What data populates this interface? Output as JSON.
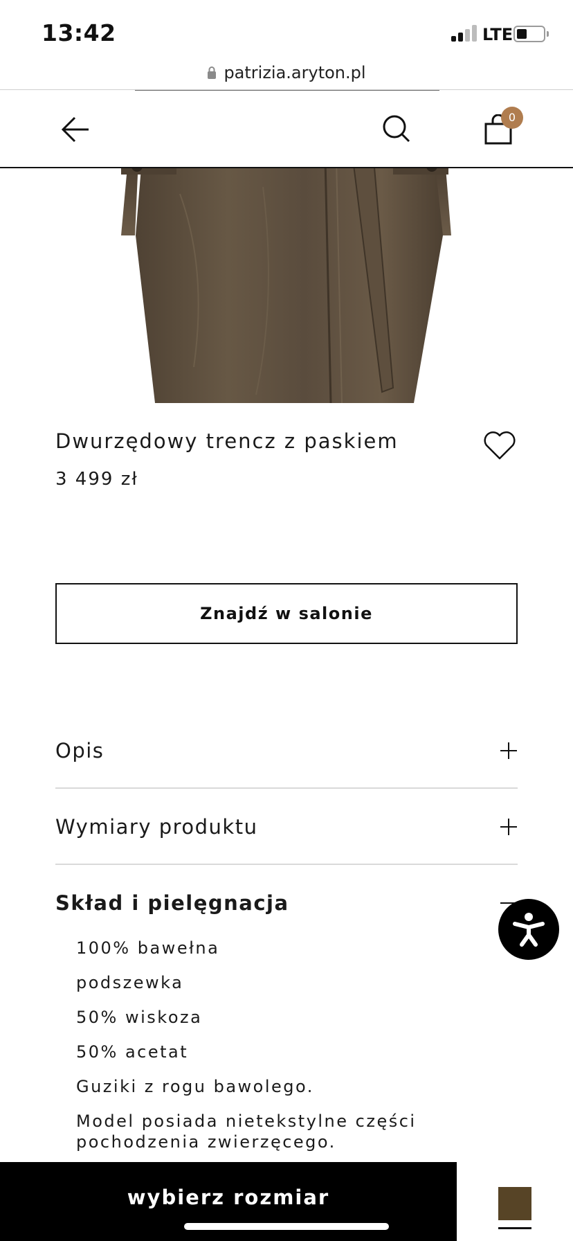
{
  "status_bar": {
    "time": "13:42",
    "network": "LTE",
    "signal_bars_active": 2,
    "signal_bars_total": 4,
    "battery_level": 0.3
  },
  "browser": {
    "url": "patrizia.aryton.pl",
    "lock_icon": "lock-icon"
  },
  "header": {
    "back_icon": "arrow-left-icon",
    "search_icon": "search-icon",
    "cart_icon": "shopping-bag-icon",
    "cart_count": "0",
    "badge_color": "#b07d4f"
  },
  "product": {
    "title": "Dwurzędowy trencz z paskiem",
    "price": "3 499 zł",
    "image_color": "#5a4c3d",
    "wishlist_icon": "heart-icon"
  },
  "store_button": {
    "label": "Znajdź w salonie"
  },
  "accordion": [
    {
      "title": "Opis",
      "icon": "plus-icon",
      "expanded": false
    },
    {
      "title": "Wymiary produktu",
      "icon": "plus-icon",
      "expanded": false
    },
    {
      "title": "Skład i pielęgnacja",
      "icon": "minus-icon",
      "expanded": true,
      "items": [
        "100% bawełna",
        "podszewka",
        "50% wiskoza",
        "50% acetat",
        "Guziki z rogu bawolego.",
        "Model posiada nietekstylne części pochodzenia zwierzęcego."
      ]
    }
  ],
  "accessibility_button": {
    "icon": "accessibility-icon"
  },
  "bottom_bar": {
    "size_label": "wybierz rozmiar",
    "swatch_color": "#574426"
  }
}
